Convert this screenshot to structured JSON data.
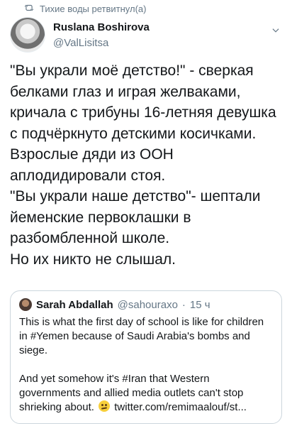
{
  "retweet": {
    "icon": "retweet-icon",
    "label": "Тихие воды ретвитнул(а)"
  },
  "author": {
    "name": "Ruslana Boshirova",
    "handle": "@ValLisitsa",
    "avatar": "avatar-woman-sunglasses"
  },
  "tweet": {
    "text": "\"Вы украли моё детство!\" - сверкая белками глаз и играя желваками, кричала с трибуны 16-летняя девушка с подчёркнуто детскими косичками. Взрослые дяди из ООН аплодидировали стоя.\n\"Вы украли наше детство\"- шептали йеменские первоклашки в разбомбленной школе.\nНо их никто не слышал."
  },
  "quoted_tweet": {
    "name": "Sarah Abdallah",
    "handle": "@sahouraxo",
    "separator": "·",
    "age": "15 ч",
    "body_1": "This is what the first day of school is like for children in #Yemen because of Saudi Arabia's bombs and siege.\n\nAnd yet somehow it's #Iran that Western governments and allied media outlets can't stop shrieking about.",
    "emoji": "grimacing-face-emoji",
    "link": "twitter.com/remimaalouf/st..."
  },
  "colors": {
    "text": "#14171a",
    "secondary": "#657786",
    "border": "#ccd6dd"
  }
}
